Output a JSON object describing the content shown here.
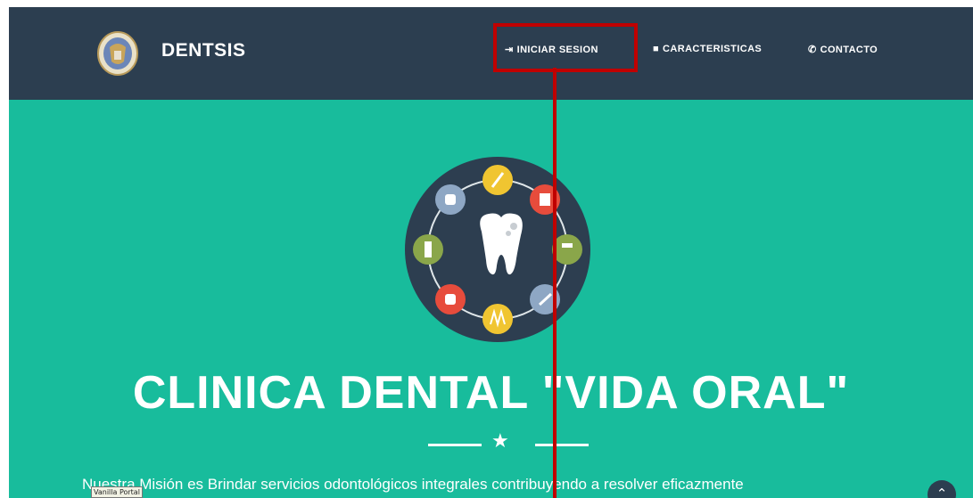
{
  "navbar": {
    "brand": "DENTSIS",
    "items": [
      {
        "label": "INICIAR SESION",
        "icon": "sign-in-icon"
      },
      {
        "label": "CARACTERISTICAS",
        "icon": "briefcase-icon"
      },
      {
        "label": "CONTACTO",
        "icon": "phone-icon"
      }
    ]
  },
  "hero": {
    "title": "CLINICA DENTAL \"VIDA ORAL\"",
    "mission": "Nuestra Misión es Brindar servicios odontológicos integrales contribuyendo a resolver eficazmente"
  },
  "tooltip": "Vanilla Portal",
  "colors": {
    "navbar": "#2c3e50",
    "hero": "#18bc9c",
    "highlight": "#c00000"
  }
}
